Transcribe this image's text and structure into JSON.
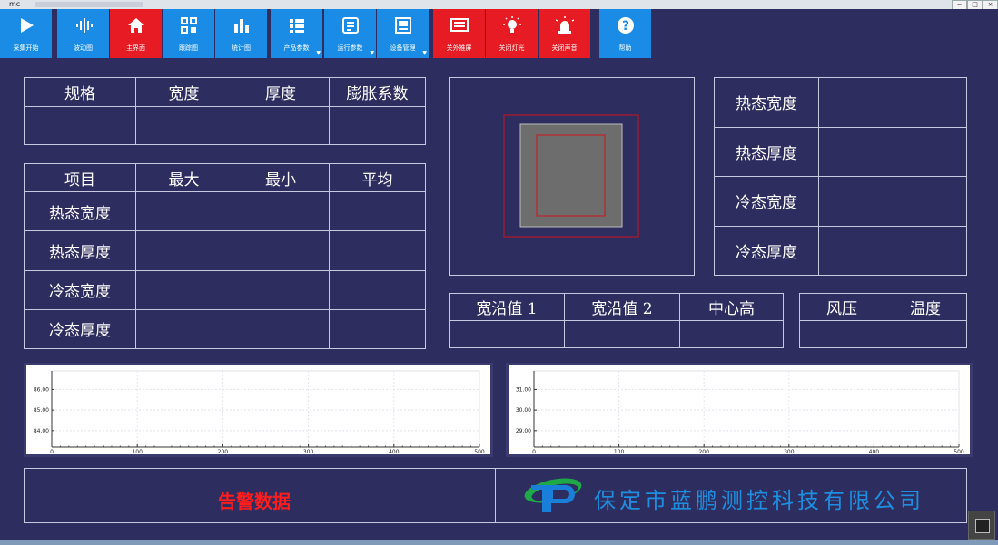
{
  "window": {
    "title": "mc"
  },
  "toolbar": [
    {
      "label": "采集开始",
      "color": "#1a8ce6",
      "icon": "play-icon"
    },
    {
      "label": "波动图",
      "color": "#1a8ce6",
      "icon": "waveform-icon"
    },
    {
      "label": "主界面",
      "color": "#e61b23",
      "icon": "home-icon"
    },
    {
      "label": "跟踪图",
      "color": "#1a8ce6",
      "icon": "qrcode-icon"
    },
    {
      "label": "统计图",
      "color": "#1a8ce6",
      "icon": "bar-chart-icon"
    },
    {
      "label": "产品参数",
      "color": "#1a8ce6",
      "icon": "list-icon",
      "dropdown": true
    },
    {
      "label": "运行参数",
      "color": "#1a8ce6",
      "icon": "panel-icon",
      "dropdown": true
    },
    {
      "label": "设备管理",
      "color": "#1a8ce6",
      "icon": "device-icon",
      "dropdown": true
    },
    {
      "label": "关外推屏",
      "color": "#e61b23",
      "icon": "screen-icon"
    },
    {
      "label": "关闭灯光",
      "color": "#e61b23",
      "icon": "bulb-icon"
    },
    {
      "label": "关闭声音",
      "color": "#e61b23",
      "icon": "siren-icon"
    },
    {
      "label": "帮助",
      "color": "#1a8ce6",
      "icon": "help-icon"
    }
  ],
  "spec_table": {
    "headers": [
      "规格",
      "宽度",
      "厚度",
      "膨胀系数"
    ]
  },
  "stats_table": {
    "headers": [
      "项目",
      "最大",
      "最小",
      "平均"
    ],
    "rows": [
      "热态宽度",
      "热态厚度",
      "冷态宽度",
      "冷态厚度"
    ]
  },
  "measure_table": {
    "rows": [
      "热态宽度",
      "热态厚度",
      "冷态宽度",
      "冷态厚度"
    ]
  },
  "edge_table": {
    "headers": [
      "宽沿值 1",
      "宽沿值 2",
      "中心高"
    ]
  },
  "env_table": {
    "headers": [
      "风压",
      "温度"
    ]
  },
  "chart_data": [
    {
      "type": "line",
      "x_ticks": [
        0,
        100,
        200,
        300,
        400,
        500
      ],
      "y_ticks": [
        "84.00",
        "85.00",
        "86.00"
      ],
      "xlim": [
        0,
        500
      ],
      "ylim": [
        83.2,
        86.9
      ],
      "series": []
    },
    {
      "type": "line",
      "x_ticks": [
        0,
        100,
        200,
        300,
        400,
        500
      ],
      "y_ticks": [
        "29.00",
        "30.00",
        "31.00"
      ],
      "xlim": [
        0,
        500
      ],
      "ylim": [
        28.2,
        31.9
      ],
      "series": []
    }
  ],
  "alarm": {
    "label": "告警数据",
    "color": "#ff1d1d"
  },
  "company": {
    "name": "保定市蓝鹏测控科技有限公司",
    "color": "#1e8fe0"
  }
}
